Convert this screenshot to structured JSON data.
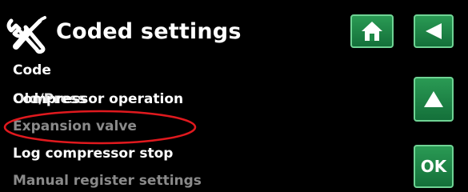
{
  "header": {
    "title": "Coded settings",
    "icon": "tools-icon"
  },
  "buttons": {
    "home": "home-icon",
    "back": "back-arrow-icon",
    "up": "up-arrow-icon",
    "ok_label": "OK"
  },
  "menu": {
    "items": [
      {
        "label": "Code",
        "state": "active"
      },
      {
        "label": "Compressor operation",
        "state": "active"
      },
      {
        "label": "Old/Press",
        "state": "active"
      },
      {
        "label": "Expansion valve",
        "state": "disabled"
      },
      {
        "label": "Log compressor stop",
        "state": "active"
      },
      {
        "label": "Manual register settings",
        "state": "disabled"
      }
    ]
  },
  "colors": {
    "background": "#000000",
    "button_green": "#1f8a48",
    "active_text": "#ffffff",
    "disabled_text": "#8a8a8a",
    "annotation": "#e0191e"
  }
}
